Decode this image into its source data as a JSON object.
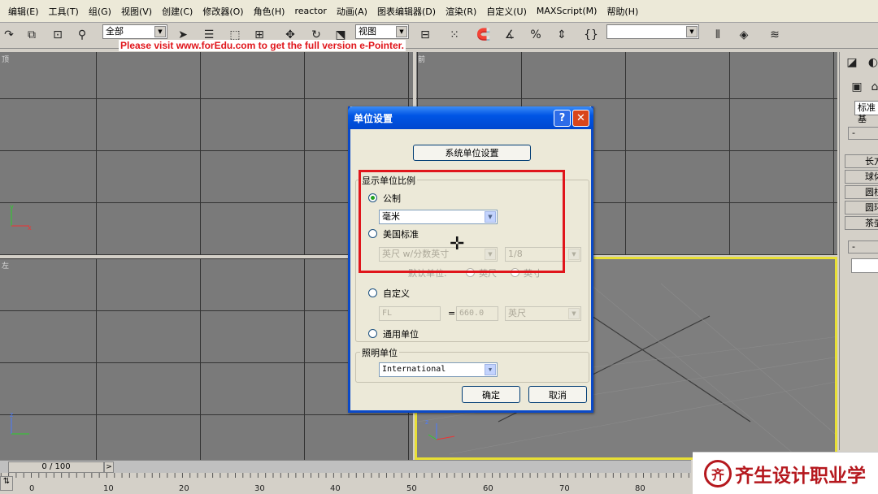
{
  "menu": [
    "编辑(E)",
    "工具(T)",
    "组(G)",
    "视图(V)",
    "创建(C)",
    "修改器(O)",
    "角色(H)",
    "reactor",
    "动画(A)",
    "图表编辑器(D)",
    "渲染(R)",
    "自定义(U)",
    "MAXScript(M)",
    "帮助(H)"
  ],
  "toolbar": {
    "selection_filter": "全部",
    "ref_coord": "视图",
    "named_selection": ""
  },
  "promo_text": "Please visit www.forEdu.com to get the full version e-Pointer.",
  "viewports": {
    "top_label": "顶",
    "front_label": "前",
    "left_label": "左",
    "axis_x": "x",
    "axis_y": "y",
    "axis_z": "z"
  },
  "command_panel": {
    "dropdown": "标准基",
    "minus_1": "-",
    "minus_2": "-",
    "buttons": [
      "长方",
      "球体",
      "圆柱",
      "圆环",
      "茶壶"
    ]
  },
  "dialog": {
    "title": "单位设置",
    "system_units_button": "系统单位设置",
    "display_group_title": "显示单位比例",
    "metric_label": "公制",
    "metric_value": "毫米",
    "us_label": "美国标准",
    "us_value": "英尺 w/分数英寸",
    "us_fraction": "1/8",
    "default_units_label": "默认单位:",
    "feet_label": "英尺",
    "inches_label": "英寸",
    "custom_label": "自定义",
    "custom_name": "FL",
    "custom_equals": "=",
    "custom_value": "660.0",
    "custom_unit": "英尺",
    "generic_label": "通用单位",
    "lighting_group_title": "照明单位",
    "lighting_value": "International",
    "ok_button": "确定",
    "cancel_button": "取消",
    "selected_system": "metric"
  },
  "timeline": {
    "frame_display": "0 / 100",
    "next_symbol": ">",
    "ticks": [
      "0",
      "10",
      "20",
      "30",
      "40",
      "50",
      "60",
      "70",
      "80"
    ]
  },
  "school_banner": {
    "logo_text": "齐",
    "name": "齐生设计职业学"
  },
  "colors": {
    "highlight": "#e0151b",
    "active_viewport_border": "#e8df35",
    "xp_title_blue": "#0055e5"
  }
}
